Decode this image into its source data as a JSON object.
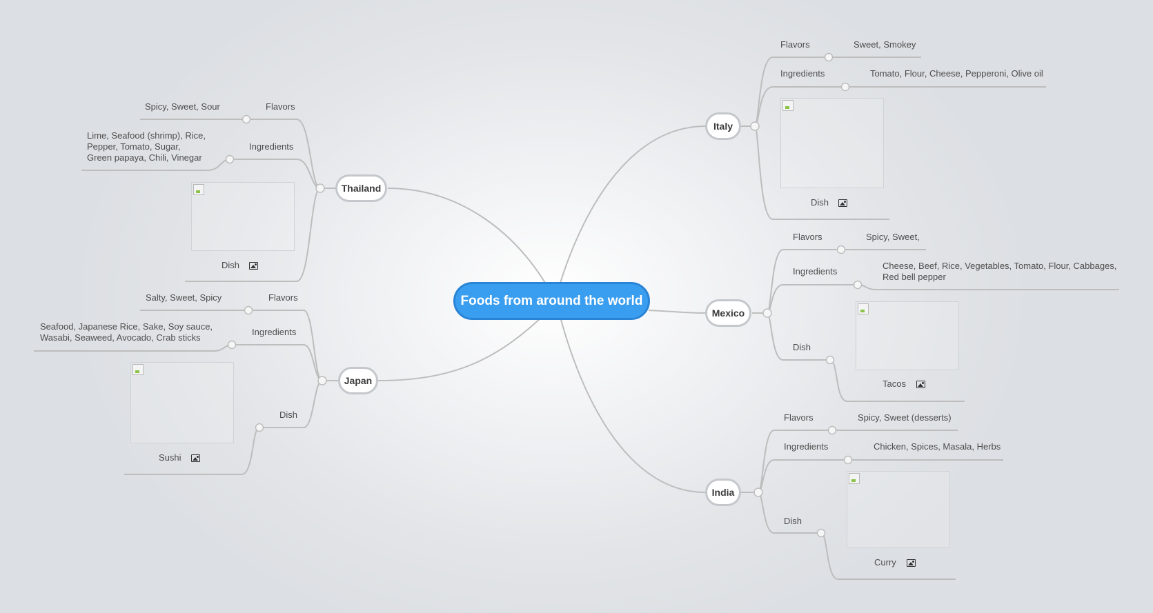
{
  "root": {
    "label": "Foods from around the world"
  },
  "labels": {
    "flavors": "Flavors",
    "ingredients": "Ingredients",
    "dish": "Dish"
  },
  "countries": {
    "thailand": {
      "name": "Thailand",
      "flavors": "Spicy, Sweet, Sour",
      "ingredients": "Lime, Seafood (shrimp), Rice,\nPepper, Tomato, Sugar,\nGreen papaya, Chili, Vinegar",
      "dish": "Dish"
    },
    "japan": {
      "name": "Japan",
      "flavors": "Salty, Sweet, Spicy",
      "ingredients": "Seafood, Japanese Rice, Sake, Soy sauce,\nWasabi, Seaweed, Avocado, Crab sticks",
      "dish": "Sushi"
    },
    "italy": {
      "name": "Italy",
      "flavors": "Sweet, Smokey",
      "ingredients": "Tomato, Flour, Cheese, Pepperoni, Olive oil",
      "dish": "Dish"
    },
    "mexico": {
      "name": "Mexico",
      "flavors": "Spicy, Sweet,",
      "ingredients": "Cheese, Beef, Rice, Vegetables, Tomato, Flour, Cabbages,\nRed bell pepper",
      "dish": "Tacos"
    },
    "india": {
      "name": "India",
      "flavors": "Spicy, Sweet (desserts)",
      "ingredients": "Chicken, Spices, Masala, Herbs",
      "dish": "Curry"
    }
  },
  "icons": {
    "dish_image": "image-icon"
  },
  "colors": {
    "root_fill": "#3a9ef0",
    "connector": "#bdbdbd",
    "country_border": "#c4c7cb"
  }
}
